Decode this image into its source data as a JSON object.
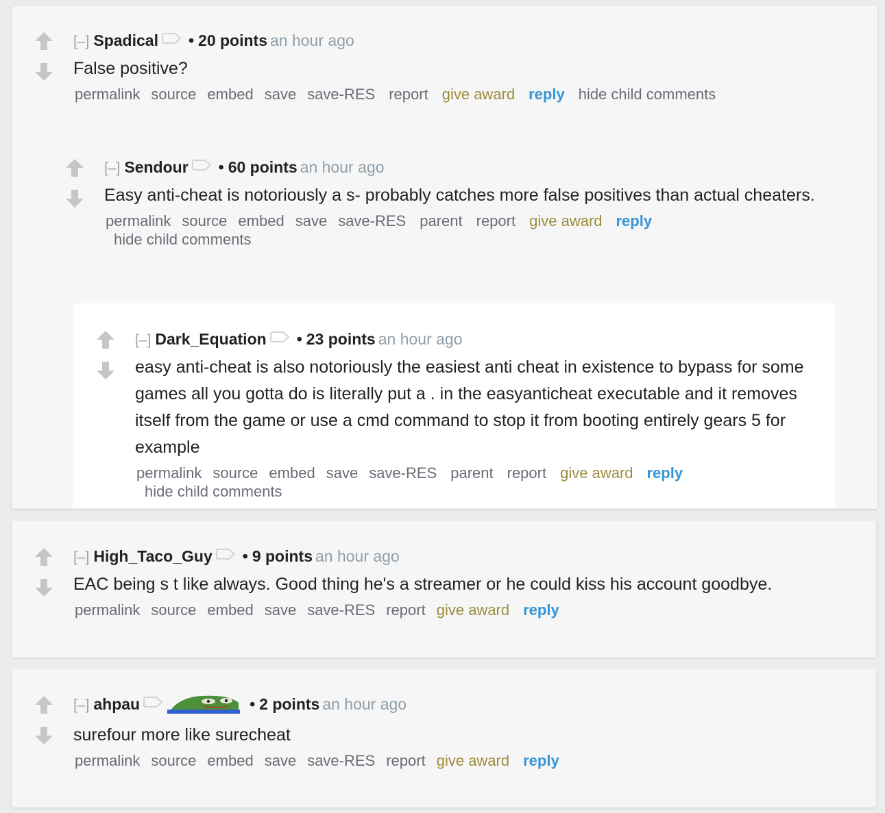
{
  "colors": {
    "page_bg": "#ececec",
    "panel_bg": "#f6f6f6",
    "nested_bg": "#ffffff",
    "text": "#222222",
    "timestamp": "#8f9ea9",
    "action_link": "#706877",
    "give_award": "#9c8c3a",
    "reply": "#3795d6",
    "vote_arrow": "#c6c6c6"
  },
  "collapse_label": "[–]",
  "bullet": "•",
  "comments": [
    {
      "author": "Spadical",
      "points": "20 points",
      "time": "an hour ago",
      "body": "False positive?",
      "actions": {
        "permalink": "permalink",
        "source": "source",
        "embed": "embed",
        "save": "save",
        "save_res": "save-RES",
        "report": "report",
        "give_award": "give award",
        "reply": "reply",
        "hide_children": "hide child comments"
      }
    },
    {
      "author": "Sendour",
      "points": "60 points",
      "time": "an hour ago",
      "body": "Easy anti-cheat is notoriously a  s- probably catches more false positives than actual cheaters.",
      "actions": {
        "permalink": "permalink",
        "source": "source",
        "embed": "embed",
        "save": "save",
        "save_res": "save-RES",
        "parent": "parent",
        "report": "report",
        "give_award": "give award",
        "reply": "reply",
        "hide_children": "hide child comments"
      }
    },
    {
      "author": "Dark_Equation",
      "points": "23 points",
      "time": "an hour ago",
      "body": "easy anti-cheat is also notoriously the easiest anti cheat in existence to bypass for some games all you gotta do is literally put a . in the easyanticheat executable and it removes itself from the game or use a cmd command to stop it from booting entirely gears 5 for example",
      "actions": {
        "permalink": "permalink",
        "source": "source",
        "embed": "embed",
        "save": "save",
        "save_res": "save-RES",
        "parent": "parent",
        "report": "report",
        "give_award": "give award",
        "reply": "reply",
        "hide_children": "hide child comments"
      }
    },
    {
      "author": "High_Taco_Guy",
      "points": "9 points",
      "time": "an hour ago",
      "body": "EAC being s   t like always. Good thing he's a streamer or he could kiss his account goodbye.",
      "actions": {
        "permalink": "permalink",
        "source": "source",
        "embed": "embed",
        "save": "save",
        "save_res": "save-RES",
        "report": "report",
        "give_award": "give award",
        "reply": "reply"
      }
    },
    {
      "author": "ahpau",
      "flair": "pepe-emote",
      "points": "2 points",
      "time": "an hour ago",
      "body": "surefour more like surecheat",
      "actions": {
        "permalink": "permalink",
        "source": "source",
        "embed": "embed",
        "save": "save",
        "save_res": "save-RES",
        "report": "report",
        "give_award": "give award",
        "reply": "reply"
      }
    }
  ]
}
